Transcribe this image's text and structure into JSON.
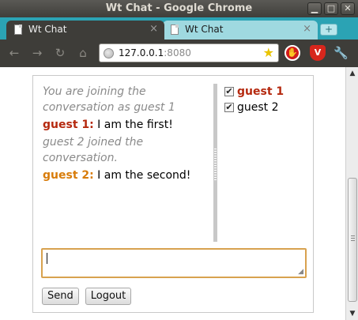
{
  "window": {
    "title": "Wt Chat - Google Chrome",
    "controls": {
      "minimize": "▁",
      "maximize": "□",
      "close": "✕"
    }
  },
  "tabs": [
    {
      "label": "Wt Chat",
      "close": "×",
      "active": true
    },
    {
      "label": "Wt Chat",
      "close": "×",
      "active": false
    }
  ],
  "new_tab_symbol": "+",
  "toolbar": {
    "back": "←",
    "forward": "→",
    "reload": "↻",
    "home": "⌂",
    "url_host": "127.0.0.1",
    "url_port": ":8080",
    "star": "★",
    "wrench": "🔧",
    "extensions": [
      "stop-sign-icon",
      "shield-icon"
    ]
  },
  "chat": {
    "messages": [
      {
        "type": "system",
        "text": "You are joining the conversation as guest 1"
      },
      {
        "type": "user",
        "who": "guest 1:",
        "text": " I am the first!",
        "color": "#b5290f"
      },
      {
        "type": "system",
        "text": "guest 2 joined the conversation."
      },
      {
        "type": "user",
        "who": "guest 2:",
        "text": " I am the second!",
        "color": "#d87c0a"
      }
    ],
    "users": [
      {
        "name": "guest 1",
        "checked": true,
        "self": true
      },
      {
        "name": "guest 2",
        "checked": true,
        "self": false
      }
    ],
    "input_value": "",
    "send_label": "Send",
    "logout_label": "Logout"
  },
  "colors": {
    "tabstrip": "#2ba3b4",
    "guest1": "#b5290f",
    "guest2": "#d87c0a",
    "input_focus": "#d8a24f"
  }
}
